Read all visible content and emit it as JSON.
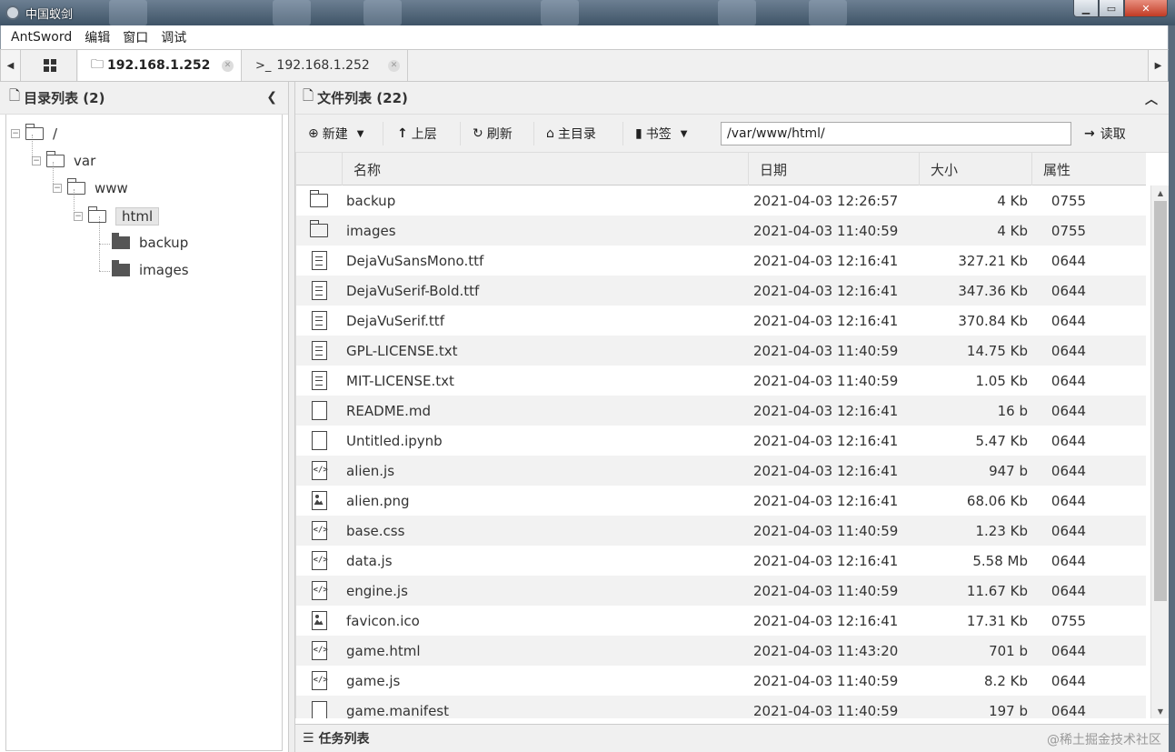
{
  "window": {
    "title": "中国蚁剑",
    "icon": "antsword-logo-icon",
    "min": "▁",
    "max": "▭",
    "close": "✕"
  },
  "menu": [
    "AntSword",
    "编辑",
    "窗口",
    "调试"
  ],
  "tabs": {
    "home_icon": "grid-icon",
    "active": {
      "label": "192.168.1.252",
      "icon": "folder-icon"
    },
    "inactive": {
      "label": "192.168.1.252",
      "icon": "terminal-icon",
      "prefix": ">_"
    }
  },
  "left_panel": {
    "title": "目录列表 (2)",
    "tree": [
      {
        "label": "/",
        "level": 0,
        "expanded": true,
        "icon": "folder-open-icon"
      },
      {
        "label": "var",
        "level": 1,
        "expanded": true,
        "icon": "folder-open-icon"
      },
      {
        "label": "www",
        "level": 2,
        "expanded": true,
        "icon": "folder-open-icon"
      },
      {
        "label": "html",
        "level": 3,
        "expanded": true,
        "selected": true,
        "icon": "folder-open-icon"
      },
      {
        "label": "backup",
        "level": 4,
        "icon": "folder-solid-icon"
      },
      {
        "label": "images",
        "level": 4,
        "icon": "folder-solid-icon"
      }
    ]
  },
  "right_panel": {
    "title": "文件列表 (22)",
    "toolbar": {
      "new": "新建",
      "up": "上层",
      "refresh": "刷新",
      "home": "主目录",
      "bookmark": "书签",
      "path": "/var/www/html/",
      "read": "读取"
    },
    "columns": [
      "名称",
      "日期",
      "大小",
      "属性"
    ],
    "files": [
      {
        "name": "backup",
        "date": "2021-04-03 12:26:57",
        "size": "4 Kb",
        "attr": "0755",
        "type": "folder"
      },
      {
        "name": "images",
        "date": "2021-04-03 11:40:59",
        "size": "4 Kb",
        "attr": "0755",
        "type": "folder"
      },
      {
        "name": "DejaVuSansMono.ttf",
        "date": "2021-04-03 12:16:41",
        "size": "327.21 Kb",
        "attr": "0644",
        "type": "text"
      },
      {
        "name": "DejaVuSerif-Bold.ttf",
        "date": "2021-04-03 12:16:41",
        "size": "347.36 Kb",
        "attr": "0644",
        "type": "text"
      },
      {
        "name": "DejaVuSerif.ttf",
        "date": "2021-04-03 12:16:41",
        "size": "370.84 Kb",
        "attr": "0644",
        "type": "text"
      },
      {
        "name": "GPL-LICENSE.txt",
        "date": "2021-04-03 11:40:59",
        "size": "14.75 Kb",
        "attr": "0644",
        "type": "text"
      },
      {
        "name": "MIT-LICENSE.txt",
        "date": "2021-04-03 11:40:59",
        "size": "1.05 Kb",
        "attr": "0644",
        "type": "text"
      },
      {
        "name": "README.md",
        "date": "2021-04-03 12:16:41",
        "size": "16 b",
        "attr": "0644",
        "type": "blank"
      },
      {
        "name": "Untitled.ipynb",
        "date": "2021-04-03 12:16:41",
        "size": "5.47 Kb",
        "attr": "0644",
        "type": "blank"
      },
      {
        "name": "alien.js",
        "date": "2021-04-03 12:16:41",
        "size": "947 b",
        "attr": "0644",
        "type": "code"
      },
      {
        "name": "alien.png",
        "date": "2021-04-03 12:16:41",
        "size": "68.06 Kb",
        "attr": "0644",
        "type": "image"
      },
      {
        "name": "base.css",
        "date": "2021-04-03 11:40:59",
        "size": "1.23 Kb",
        "attr": "0644",
        "type": "code"
      },
      {
        "name": "data.js",
        "date": "2021-04-03 12:16:41",
        "size": "5.58 Mb",
        "attr": "0644",
        "type": "code"
      },
      {
        "name": "engine.js",
        "date": "2021-04-03 11:40:59",
        "size": "11.67 Kb",
        "attr": "0644",
        "type": "code"
      },
      {
        "name": "favicon.ico",
        "date": "2021-04-03 12:16:41",
        "size": "17.31 Kb",
        "attr": "0755",
        "type": "image"
      },
      {
        "name": "game.html",
        "date": "2021-04-03 11:43:20",
        "size": "701 b",
        "attr": "0644",
        "type": "code"
      },
      {
        "name": "game.js",
        "date": "2021-04-03 11:40:59",
        "size": "8.2 Kb",
        "attr": "0644",
        "type": "code"
      },
      {
        "name": "game.manifest",
        "date": "2021-04-03 11:40:59",
        "size": "197 b",
        "attr": "0644",
        "type": "blank"
      }
    ]
  },
  "task_bar": {
    "title": "任务列表"
  },
  "watermark": "@稀土掘金技术社区"
}
